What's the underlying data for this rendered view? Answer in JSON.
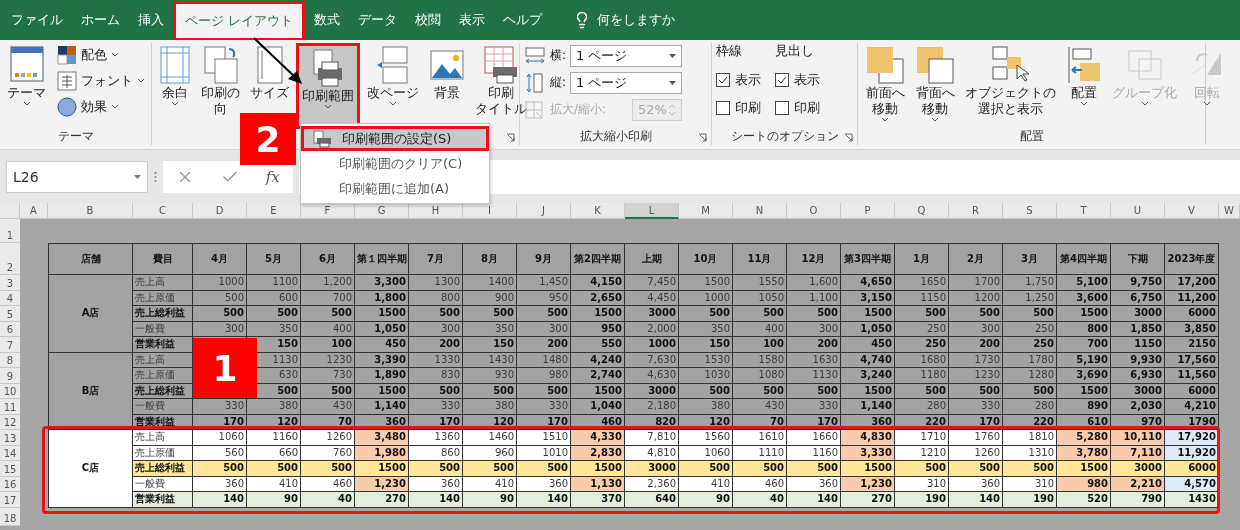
{
  "menu": {
    "tabs": [
      {
        "label": "ファイル",
        "selected": false
      },
      {
        "label": "ホーム",
        "selected": false
      },
      {
        "label": "挿入",
        "selected": false
      },
      {
        "label": "ページ レイアウト",
        "selected": true
      },
      {
        "label": "数式",
        "selected": false
      },
      {
        "label": "データ",
        "selected": false
      },
      {
        "label": "校閲",
        "selected": false
      },
      {
        "label": "表示",
        "selected": false
      },
      {
        "label": "ヘルプ",
        "selected": false
      }
    ],
    "tell_me": "何をしますか"
  },
  "ribbon": {
    "themes": {
      "label": "テーマ",
      "main": "テーマ",
      "items": [
        {
          "kind": "colors",
          "label": "配色"
        },
        {
          "kind": "fonts",
          "label": "フォント"
        },
        {
          "kind": "effects",
          "label": "効果"
        }
      ]
    },
    "page_setup": {
      "buttons": [
        {
          "kind": "margins",
          "lines": [
            "余白"
          ],
          "dropdown": true,
          "selected": false
        },
        {
          "kind": "orientation",
          "lines": [
            "印刷の",
            "向"
          ],
          "dropdown": false,
          "selected": false
        },
        {
          "kind": "size",
          "lines": [
            "サイズ"
          ],
          "dropdown": false,
          "selected": false
        },
        {
          "kind": "print_area",
          "lines": [
            "印刷範囲"
          ],
          "dropdown": true,
          "selected": true
        },
        {
          "kind": "breaks",
          "lines": [
            "改ページ"
          ],
          "dropdown": true,
          "selected": false
        },
        {
          "kind": "background",
          "lines": [
            "背景"
          ],
          "dropdown": false,
          "selected": false
        },
        {
          "kind": "print_titles",
          "lines": [
            "印刷",
            "タイトル"
          ],
          "dropdown": false,
          "selected": false
        }
      ]
    },
    "scale": {
      "label": "拡大縮小印刷",
      "fields": [
        {
          "kind": "width",
          "label": "横:",
          "value": "1 ページ",
          "disabled": false
        },
        {
          "kind": "height",
          "label": "縦:",
          "value": "1 ページ",
          "disabled": false
        },
        {
          "kind": "zoom",
          "label": "拡大/縮小:",
          "value": "52%",
          "disabled": true
        }
      ]
    },
    "sheet_options": {
      "label": "シートのオプション",
      "columns": [
        {
          "title": "枠線",
          "options": [
            {
              "label": "表示",
              "checked": true
            },
            {
              "label": "印刷",
              "checked": false
            }
          ]
        },
        {
          "title": "見出し",
          "options": [
            {
              "label": "表示",
              "checked": true
            },
            {
              "label": "印刷",
              "checked": false
            }
          ]
        }
      ]
    },
    "arrange": {
      "label": "配置",
      "buttons": [
        {
          "kind": "bring_forward",
          "lines": [
            "前面へ",
            "移動"
          ],
          "dropdown": true,
          "disabled": false
        },
        {
          "kind": "send_backward",
          "lines": [
            "背面へ",
            "移動"
          ],
          "dropdown": true,
          "disabled": false
        },
        {
          "kind": "selection_pane",
          "lines": [
            "オブジェクトの",
            "選択と表示"
          ],
          "dropdown": false,
          "disabled": false
        },
        {
          "kind": "align",
          "lines": [
            "配置"
          ],
          "dropdown": true,
          "disabled": false
        },
        {
          "kind": "group",
          "lines": [
            "グループ化"
          ],
          "dropdown": true,
          "disabled": true
        },
        {
          "kind": "rotate",
          "lines": [
            "回転"
          ],
          "dropdown": true,
          "disabled": true
        }
      ]
    }
  },
  "print_area_menu": {
    "items": [
      {
        "kind": "set",
        "label": "印刷範囲の設定(S)",
        "selected": true
      },
      {
        "kind": "clear",
        "label": "印刷範囲のクリア(C)",
        "selected": false
      },
      {
        "kind": "add",
        "label": "印刷範囲に追加(A)",
        "selected": false
      }
    ]
  },
  "formula_bar": {
    "name_box": "L26",
    "function_label": "fx"
  },
  "sheet": {
    "columns": [
      {
        "label": "A",
        "selected": false
      },
      {
        "label": "B",
        "selected": false
      },
      {
        "label": "C",
        "selected": false
      },
      {
        "label": "D",
        "selected": false
      },
      {
        "label": "E",
        "selected": false
      },
      {
        "label": "F",
        "selected": false
      },
      {
        "label": "G",
        "selected": false
      },
      {
        "label": "H",
        "selected": false
      },
      {
        "label": "I",
        "selected": false
      },
      {
        "label": "J",
        "selected": false
      },
      {
        "label": "K",
        "selected": false
      },
      {
        "label": "L",
        "selected": true
      },
      {
        "label": "M",
        "selected": false
      },
      {
        "label": "N",
        "selected": false
      },
      {
        "label": "O",
        "selected": false
      },
      {
        "label": "P",
        "selected": false
      },
      {
        "label": "Q",
        "selected": false
      },
      {
        "label": "R",
        "selected": false
      },
      {
        "label": "S",
        "selected": false
      },
      {
        "label": "T",
        "selected": false
      },
      {
        "label": "U",
        "selected": false
      },
      {
        "label": "V",
        "selected": false
      },
      {
        "label": "W",
        "selected": false
      }
    ],
    "rows": [
      "1",
      "2",
      "3",
      "4",
      "5",
      "6",
      "7",
      "8",
      "9",
      "10",
      "11",
      "12",
      "13",
      "14",
      "15",
      "16",
      "17",
      "18"
    ],
    "header": {
      "store": "店舗",
      "item": "費目",
      "periods": [
        {
          "label": "4月",
          "kind": "month"
        },
        {
          "label": "5月",
          "kind": "month"
        },
        {
          "label": "6月",
          "kind": "month"
        },
        {
          "label": "第１四半期",
          "kind": "quarter"
        },
        {
          "label": "7月",
          "kind": "month"
        },
        {
          "label": "8月",
          "kind": "month"
        },
        {
          "label": "9月",
          "kind": "month"
        },
        {
          "label": "第2四半期",
          "kind": "quarter"
        },
        {
          "label": "上期",
          "kind": "first_half"
        },
        {
          "label": "10月",
          "kind": "month"
        },
        {
          "label": "11月",
          "kind": "month"
        },
        {
          "label": "12月",
          "kind": "month"
        },
        {
          "label": "第3四半期",
          "kind": "quarter"
        },
        {
          "label": "1月",
          "kind": "month"
        },
        {
          "label": "2月",
          "kind": "month"
        },
        {
          "label": "3月",
          "kind": "month"
        },
        {
          "label": "第4四半期",
          "kind": "quarter"
        },
        {
          "label": "下期",
          "kind": "second_half"
        },
        {
          "label": "2023年度",
          "kind": "year"
        }
      ]
    },
    "stores": [
      {
        "name": "A店",
        "selected": false,
        "rows": [
          {
            "label": "売上高",
            "kind": "sales",
            "values": [
              "1000",
              "1100",
              "1,200",
              "3,300",
              "1300",
              "1400",
              "1,450",
              "4,150",
              "7,450",
              "1500",
              "1550",
              "1,600",
              "4,650",
              "1650",
              "1700",
              "1,750",
              "5,100",
              "9,750",
              "17,200"
            ]
          },
          {
            "label": "売上原価",
            "kind": "cost",
            "values": [
              "500",
              "600",
              "700",
              "1,800",
              "800",
              "900",
              "950",
              "2,650",
              "4,450",
              "1000",
              "1050",
              "1,100",
              "3,150",
              "1150",
              "1200",
              "1,250",
              "3,600",
              "6,750",
              "11,200"
            ]
          },
          {
            "label": "売上総利益",
            "kind": "gross",
            "values": [
              "500",
              "500",
              "500",
              "1500",
              "500",
              "500",
              "500",
              "1500",
              "3000",
              "500",
              "500",
              "500",
              "1500",
              "500",
              "500",
              "500",
              "1500",
              "3000",
              "6000"
            ]
          },
          {
            "label": "一般費",
            "kind": "expense",
            "values": [
              "300",
              "350",
              "400",
              "1,050",
              "300",
              "350",
              "300",
              "950",
              "2,000",
              "350",
              "400",
              "300",
              "1,050",
              "250",
              "300",
              "250",
              "800",
              "1,850",
              "3,850"
            ]
          },
          {
            "label": "営業利益",
            "kind": "operating",
            "first_cell_covered": true,
            "values": [
              "150",
              "100",
              "450",
              "200",
              "150",
              "200",
              "550",
              "1000",
              "150",
              "100",
              "200",
              "450",
              "250",
              "200",
              "250",
              "700",
              "1150",
              "2150"
            ]
          }
        ]
      },
      {
        "name": "B店",
        "selected": false,
        "rows": [
          {
            "label": "売上高",
            "kind": "sales",
            "first_cell_covered": true,
            "values": [
              "1130",
              "1230",
              "3,390",
              "1330",
              "1430",
              "1480",
              "4,240",
              "7,630",
              "1530",
              "1580",
              "1630",
              "4,740",
              "1680",
              "1730",
              "1780",
              "5,190",
              "9,930",
              "17,560"
            ]
          },
          {
            "label": "売上原価",
            "kind": "cost",
            "first_cell_covered": true,
            "values": [
              "630",
              "730",
              "1,890",
              "830",
              "930",
              "980",
              "2,740",
              "4,630",
              "1030",
              "1080",
              "1130",
              "3,240",
              "1180",
              "1230",
              "1280",
              "3,690",
              "6,930",
              "11,560"
            ]
          },
          {
            "label": "売上総利益",
            "kind": "gross",
            "first_cell_covered": true,
            "values": [
              "500",
              "500",
              "1500",
              "500",
              "500",
              "500",
              "1500",
              "3000",
              "500",
              "500",
              "500",
              "1500",
              "500",
              "500",
              "500",
              "1500",
              "3000",
              "6000"
            ]
          },
          {
            "label": "一般費",
            "kind": "expense",
            "values": [
              "330",
              "380",
              "430",
              "1,140",
              "330",
              "380",
              "330",
              "1,040",
              "2,180",
              "380",
              "430",
              "330",
              "1,140",
              "280",
              "330",
              "280",
              "890",
              "2,030",
              "4,210"
            ]
          },
          {
            "label": "営業利益",
            "kind": "operating",
            "values": [
              "170",
              "120",
              "70",
              "360",
              "170",
              "120",
              "170",
              "460",
              "820",
              "120",
              "70",
              "170",
              "360",
              "220",
              "170",
              "220",
              "610",
              "970",
              "1790"
            ]
          }
        ]
      },
      {
        "name": "C店",
        "selected": true,
        "rows": [
          {
            "label": "売上高",
            "kind": "sales",
            "values": [
              "1060",
              "1160",
              "1260",
              "3,480",
              "1360",
              "1460",
              "1510",
              "4,330",
              "7,810",
              "1560",
              "1610",
              "1660",
              "4,830",
              "1710",
              "1760",
              "1810",
              "5,280",
              "10,110",
              "17,920"
            ]
          },
          {
            "label": "売上原価",
            "kind": "cost",
            "values": [
              "560",
              "660",
              "760",
              "1,980",
              "860",
              "960",
              "1010",
              "2,830",
              "4,810",
              "1060",
              "1110",
              "1160",
              "3,330",
              "1210",
              "1260",
              "1310",
              "3,780",
              "7,110",
              "11,920"
            ]
          },
          {
            "label": "売上総利益",
            "kind": "gross",
            "values": [
              "500",
              "500",
              "500",
              "1500",
              "500",
              "500",
              "500",
              "1500",
              "3000",
              "500",
              "500",
              "500",
              "1500",
              "500",
              "500",
              "500",
              "1500",
              "3000",
              "6000"
            ]
          },
          {
            "label": "一般費",
            "kind": "expense",
            "values": [
              "360",
              "410",
              "460",
              "1,230",
              "360",
              "410",
              "360",
              "1,130",
              "2,360",
              "410",
              "460",
              "360",
              "1,230",
              "310",
              "360",
              "310",
              "980",
              "2,210",
              "4,570"
            ]
          },
          {
            "label": "営業利益",
            "kind": "operating",
            "values": [
              "140",
              "90",
              "40",
              "270",
              "140",
              "90",
              "140",
              "370",
              "640",
              "90",
              "40",
              "140",
              "270",
              "190",
              "140",
              "190",
              "520",
              "790",
              "1430"
            ]
          }
        ]
      }
    ]
  },
  "callouts": [
    {
      "label": "1"
    },
    {
      "label": "2"
    }
  ]
}
